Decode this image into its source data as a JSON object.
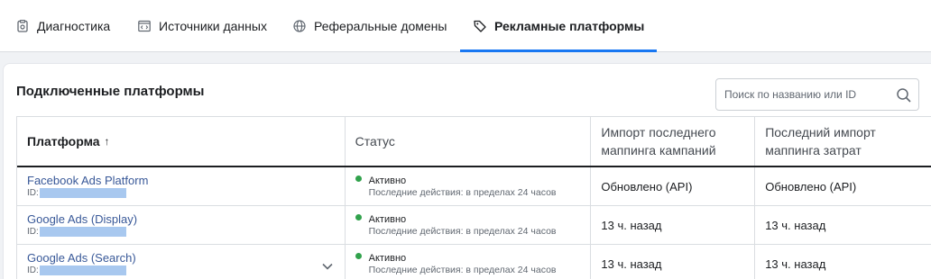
{
  "tabs": [
    {
      "label": "Диагностика",
      "icon": "diagnostics-icon"
    },
    {
      "label": "Источники данных",
      "icon": "code-window-icon"
    },
    {
      "label": "Реферальные домены",
      "icon": "globe-icon"
    },
    {
      "label": "Рекламные платформы",
      "icon": "tag-icon",
      "active": true
    }
  ],
  "accent_color": "#1877f2",
  "status_color": "#31a24c",
  "card": {
    "title": "Подключенные платформы",
    "search_placeholder": "Поиск по названию или ID"
  },
  "table": {
    "columns": [
      {
        "label": "Платформа",
        "sort": "↑"
      },
      {
        "label": "Статус"
      },
      {
        "label": "Импорт последнего маппинга кампаний"
      },
      {
        "label": "Последний импорт маппинга затрат"
      }
    ],
    "rows": [
      {
        "platform": "Facebook Ads Platform",
        "id_label": "ID:",
        "status": "Активно",
        "status_detail": "Последние действия: в пределах 24 часов",
        "campaign_import": "Обновлено (API)",
        "cost_import": "Обновлено (API)"
      },
      {
        "platform": "Google Ads (Display)",
        "id_label": "ID:",
        "status": "Активно",
        "status_detail": "Последние действия: в пределах 24 часов",
        "campaign_import": "13 ч. назад",
        "cost_import": "13 ч. назад"
      },
      {
        "platform": "Google Ads (Search)",
        "id_label": "ID:",
        "status": "Активно",
        "status_detail": "Последние действия: в пределах 24 часов",
        "campaign_import": "13 ч. назад",
        "cost_import": "13 ч. назад",
        "expandable": true
      }
    ]
  }
}
